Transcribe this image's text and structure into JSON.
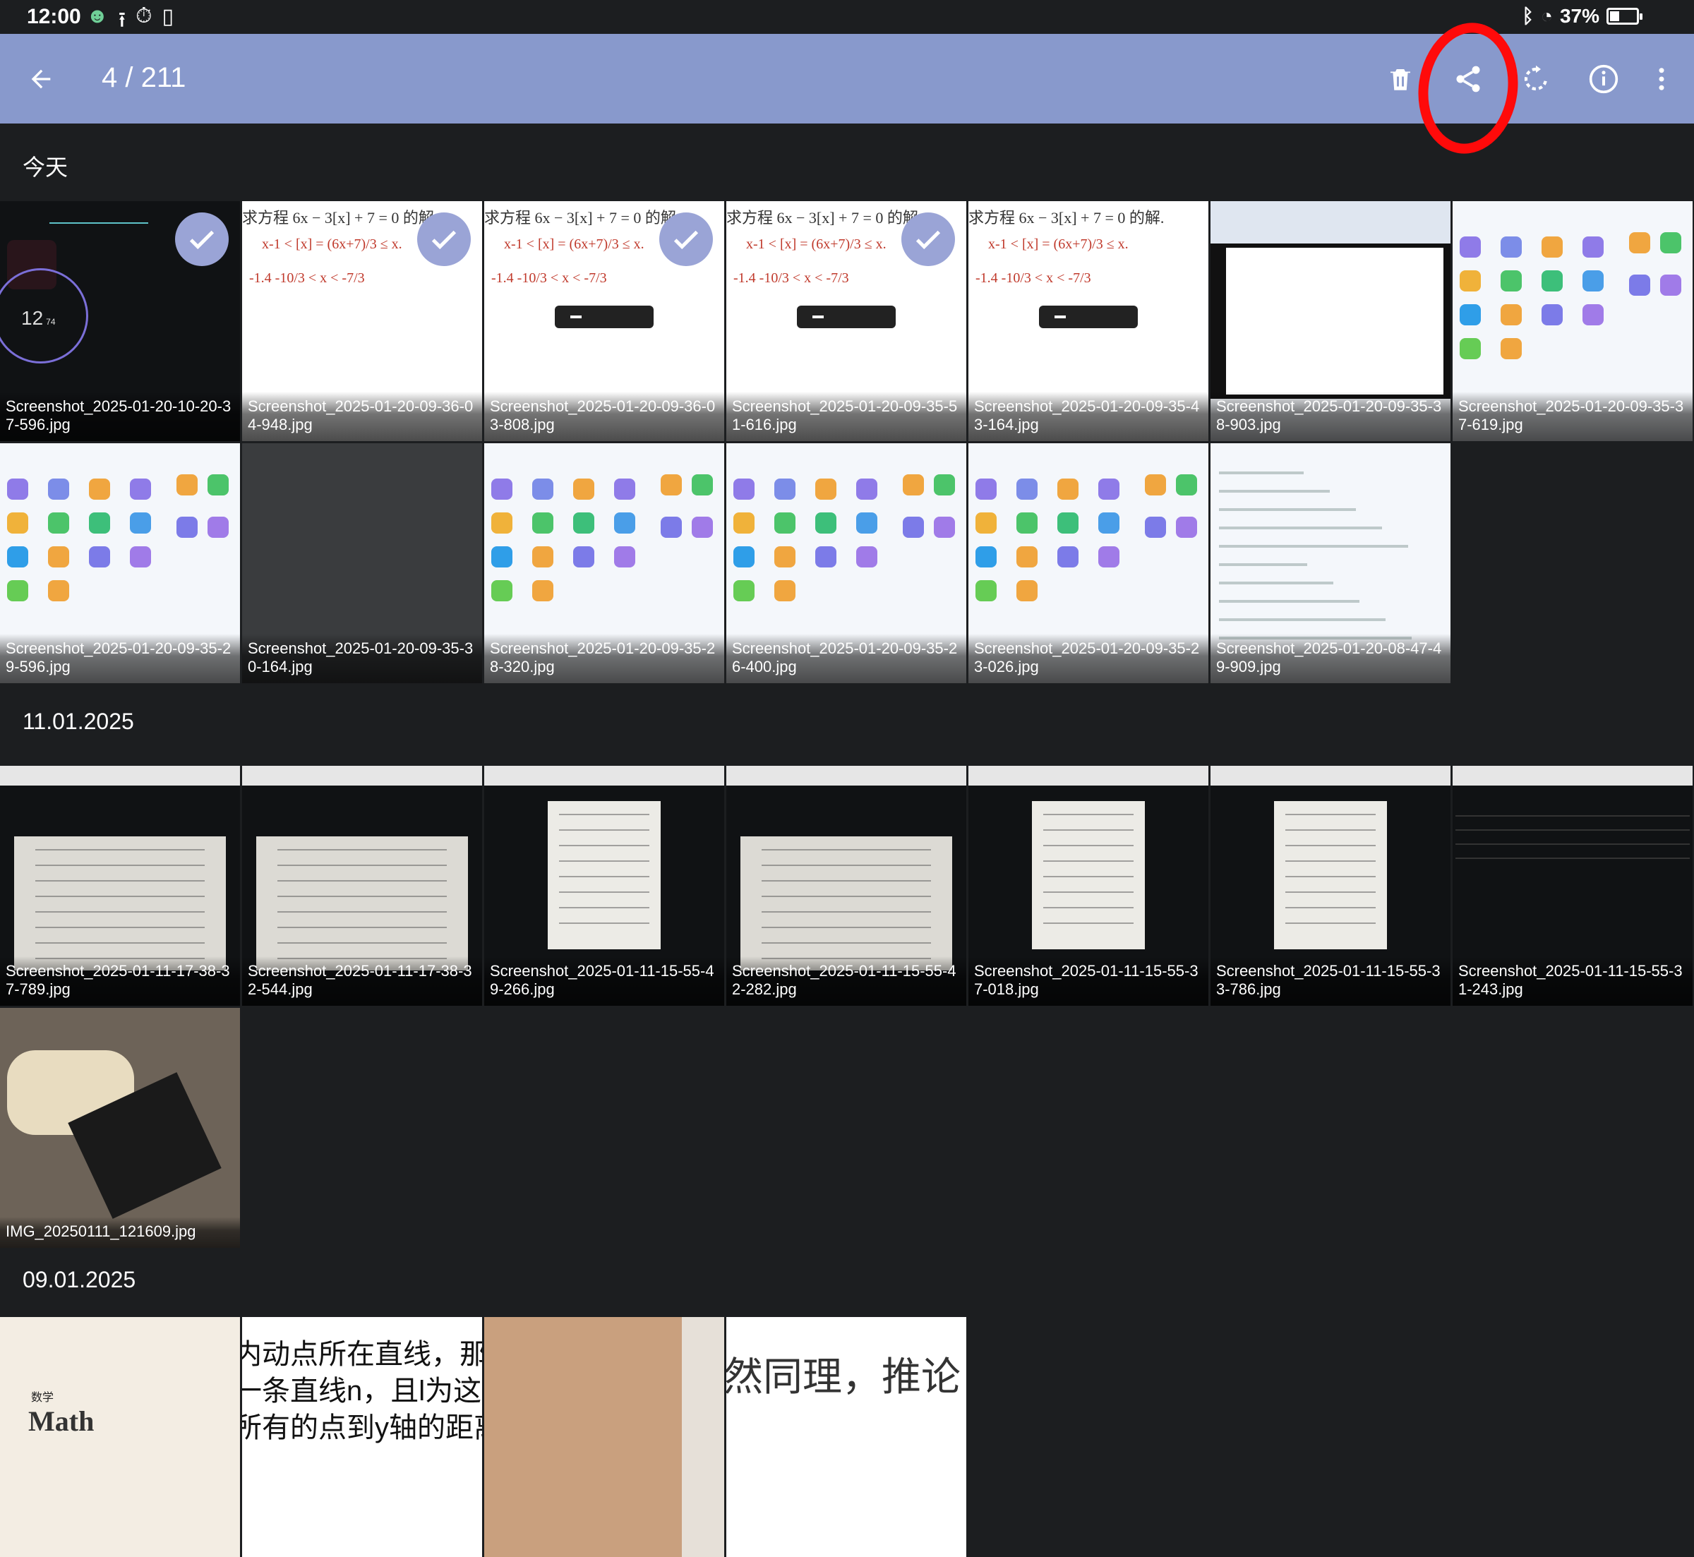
{
  "status": {
    "time": "12:00",
    "battery": "37%",
    "battery_level": 0.37
  },
  "toolbar": {
    "counter": "4 / 211",
    "icons": [
      "back-arrow-icon",
      "trash-icon",
      "share-icon",
      "rotate-icon",
      "info-icon",
      "more-vert-icon"
    ]
  },
  "colors": {
    "toolbar_bg": "#8899cc",
    "page_bg": "#1c1e20",
    "annotation": "#ff0a0a",
    "check_bg": "#9aa4d6"
  },
  "sections": [
    {
      "label": "今天",
      "items": [
        {
          "name": "Screenshot_2025-01-20-10-20-37-596.jpg",
          "selected": true,
          "kind": "timer"
        },
        {
          "name": "Screenshot_2025-01-20-09-36-04-948.jpg",
          "selected": true,
          "kind": "math"
        },
        {
          "name": "Screenshot_2025-01-20-09-36-03-808.jpg",
          "selected": true,
          "kind": "math"
        },
        {
          "name": "Screenshot_2025-01-20-09-35-51-616.jpg",
          "selected": true,
          "kind": "math"
        },
        {
          "name": "Screenshot_2025-01-20-09-35-43-164.jpg",
          "selected": false,
          "kind": "math"
        },
        {
          "name": "Screenshot_2025-01-20-09-35-38-903.jpg",
          "selected": false,
          "kind": "video"
        },
        {
          "name": "Screenshot_2025-01-20-09-35-37-619.jpg",
          "selected": false,
          "kind": "apps"
        },
        {
          "name": "Screenshot_2025-01-20-09-35-29-596.jpg",
          "selected": false,
          "kind": "apps"
        },
        {
          "name": "Screenshot_2025-01-20-09-35-30-164.jpg",
          "selected": false,
          "kind": "dim"
        },
        {
          "name": "Screenshot_2025-01-20-09-35-28-320.jpg",
          "selected": false,
          "kind": "apps"
        },
        {
          "name": "Screenshot_2025-01-20-09-35-26-400.jpg",
          "selected": false,
          "kind": "apps"
        },
        {
          "name": "Screenshot_2025-01-20-09-35-23-026.jpg",
          "selected": false,
          "kind": "apps"
        },
        {
          "name": "Screenshot_2025-01-20-08-47-49-909.jpg",
          "selected": false,
          "kind": "doc"
        }
      ]
    },
    {
      "label": "11.01.2025",
      "items": [
        {
          "name": "Screenshot_2025-01-11-17-38-37-789.jpg",
          "selected": false,
          "kind": "paper"
        },
        {
          "name": "Screenshot_2025-01-11-17-38-32-544.jpg",
          "selected": false,
          "kind": "paper"
        },
        {
          "name": "Screenshot_2025-01-11-15-55-49-266.jpg",
          "selected": false,
          "kind": "paper-dark"
        },
        {
          "name": "Screenshot_2025-01-11-15-55-42-282.jpg",
          "selected": false,
          "kind": "paper"
        },
        {
          "name": "Screenshot_2025-01-11-15-55-37-018.jpg",
          "selected": false,
          "kind": "paper-dark"
        },
        {
          "name": "Screenshot_2025-01-11-15-55-33-786.jpg",
          "selected": false,
          "kind": "paper-dark"
        },
        {
          "name": "Screenshot_2025-01-11-15-55-31-243.jpg",
          "selected": false,
          "kind": "list-dark"
        },
        {
          "name": "IMG_20250111_121609.jpg",
          "selected": false,
          "kind": "photo"
        }
      ]
    },
    {
      "label": "09.01.2025",
      "items": [
        {
          "name": "",
          "selected": false,
          "kind": "book",
          "text": "数学",
          "text2": "Math"
        },
        {
          "name": "",
          "selected": false,
          "kind": "cn-text",
          "lines": [
            "内动点所在直线，那么",
            "一条直线n，且l为这直",
            "所有的点到y轴的距离"
          ]
        },
        {
          "name": "",
          "selected": false,
          "kind": "photo2"
        },
        {
          "name": "",
          "selected": false,
          "kind": "cn-text2",
          "lines": [
            "然同理，推论"
          ]
        }
      ]
    }
  ],
  "thumb_text": {
    "math_problem": "求方程 6x − 3[x] + 7 = 0 的解.",
    "timer_value": "12",
    "timer_small": "74"
  }
}
